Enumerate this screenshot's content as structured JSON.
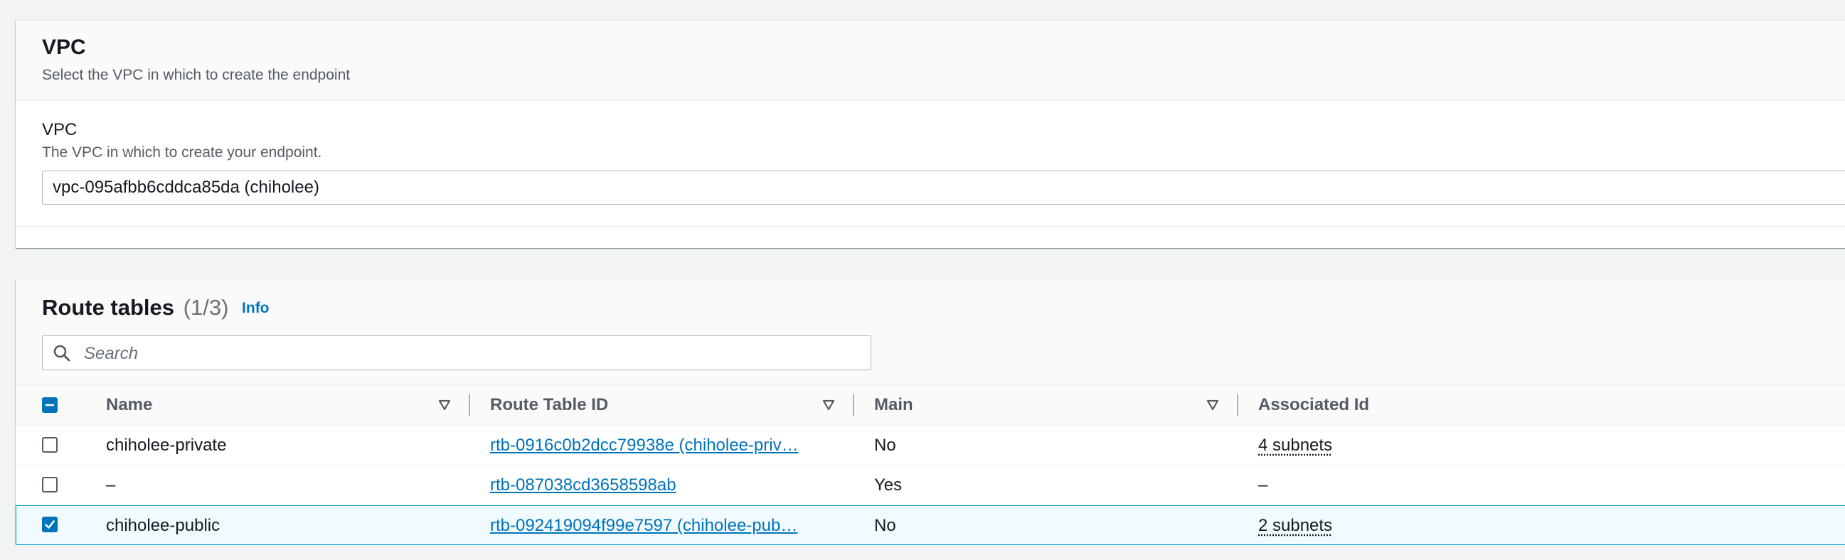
{
  "vpc_section": {
    "title": "VPC",
    "description": "Select the VPC in which to create the endpoint",
    "field_label": "VPC",
    "field_description": "The VPC in which to create your endpoint.",
    "selected_vpc": "vpc-095afbb6cddca85da (chiholee)"
  },
  "route_tables": {
    "title": "Route tables",
    "count": "(1/3)",
    "info_label": "Info",
    "search_placeholder": "Search",
    "columns": {
      "name": "Name",
      "route_table_id": "Route Table ID",
      "main": "Main",
      "associated_id": "Associated Id"
    },
    "rows": [
      {
        "selected": false,
        "name": "chiholee-private",
        "route_table_id": "rtb-0916c0b2dcc79938e (chiholee-priv…",
        "main": "No",
        "associated_id": "4 subnets"
      },
      {
        "selected": false,
        "name": "–",
        "route_table_id": "rtb-087038cd3658598ab",
        "main": "Yes",
        "associated_id": "–"
      },
      {
        "selected": true,
        "name": "chiholee-public",
        "route_table_id": "rtb-092419094f99e7597 (chiholee-pub…",
        "main": "No",
        "associated_id": "2 subnets"
      }
    ]
  },
  "colors": {
    "link": "#0073bb",
    "selected_row_bg": "#f1faff",
    "selected_row_border": "#00a1c9",
    "checkbox_checked": "#0073bb"
  }
}
